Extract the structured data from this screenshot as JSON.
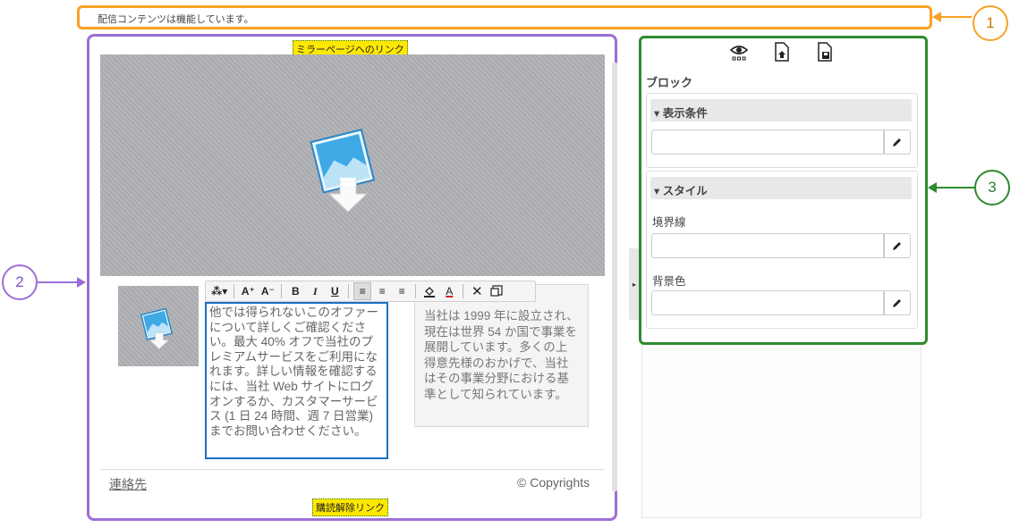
{
  "status_bar": {
    "text": "配信コンテンツは機能しています。"
  },
  "callouts": {
    "one": "1",
    "two": "2",
    "three": "3"
  },
  "editor": {
    "mirror_link": "ミラーページへのリンク",
    "unsubscribe_link": "購読解除リンク",
    "body_text": "他では得られないこのオファーについて詳しくご確認ください。最大 40% オフで当社のプレミアムサービスをご利用になれます。詳しい情報を確認するには、当社 Web サイトにログオンするか、カスタマーサービス (1 日 24 時間、週 7 日営業) までお問い合わせください。",
    "side_text": "当社は 1999 年に設立され、現在は世界 54 か国で事業を展開しています。多くの上得意先様のおかげで、当社はその事業分野における基準として知られています。",
    "footer_contact": "連絡先",
    "footer_copyright": "© Copyrights"
  },
  "toolbar": {
    "format": "⁂▾",
    "font_up": "A⁺",
    "font_down": "A⁻",
    "bold": "B",
    "italic": "I",
    "underline": "U",
    "align_left": "≡",
    "align_center": "≡",
    "align_right": "≡",
    "clear": "✕",
    "text_color": "A"
  },
  "panel": {
    "block_title": "ブロック",
    "display_conditions": "▾ 表示条件",
    "style_section": "▾ スタイル",
    "border_label": "境界線",
    "bg_label": "背景色",
    "icons": [
      "eye-icon",
      "page-upload-icon",
      "save-page-icon"
    ]
  },
  "colors": {
    "orange": "#f7a125",
    "purple": "#9b6fd6",
    "green": "#2e8b2e",
    "blue": "#1f6fbf",
    "badge": "#ffe800"
  }
}
